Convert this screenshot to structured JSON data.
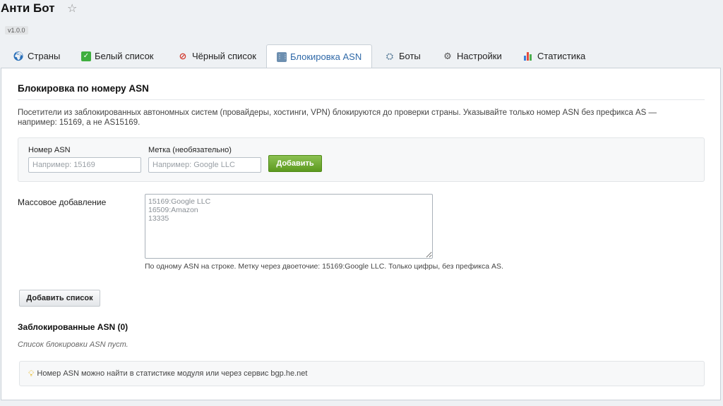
{
  "header": {
    "title": "Анти Бот",
    "version": "v1.0.0"
  },
  "tabs": [
    {
      "label": "Страны",
      "icon": "globe-icon"
    },
    {
      "label": "Белый список",
      "icon": "checkmark-icon"
    },
    {
      "label": "Чёрный список",
      "icon": "ban-icon"
    },
    {
      "label": "Блокировка ASN",
      "icon": "keypad-icon",
      "active": true
    },
    {
      "label": "Боты",
      "icon": "bot-icon"
    },
    {
      "label": "Настройки",
      "icon": "gear-icon"
    },
    {
      "label": "Статистика",
      "icon": "bar-chart-icon"
    }
  ],
  "main": {
    "title": "Блокировка по номеру ASN",
    "description": "Посетители из заблокированных автономных систем (провайдеры, хостинги, VPN) блокируются до проверки страны. Указывайте только номер ASN без префикса AS — например: 15169, а не AS15169.",
    "form": {
      "asn_label": "Номер ASN",
      "asn_placeholder": "Например: 15169",
      "tag_label": "Метка (необязательно)",
      "tag_placeholder": "Например: Google LLC",
      "add_button": "Добавить"
    },
    "bulk": {
      "label": "Массовое добавление",
      "placeholder": "15169:Google LLC\n16509:Amazon\n13335",
      "hint": "По одному ASN на строке. Метку через двоеточие: 15169:Google LLC. Только цифры, без префикса AS.",
      "button": "Добавить список"
    },
    "blocked": {
      "title": "Заблокированные ASN (0)",
      "empty": "Список блокировки ASN пуст."
    },
    "tip": "Номер ASN можно найти в статистике модуля или через сервис bgp.he.net"
  },
  "colors": {
    "accent": "#2f69a8",
    "button_green": "#6aaa2a"
  }
}
